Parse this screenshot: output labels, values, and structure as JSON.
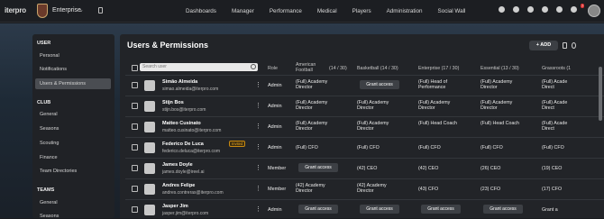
{
  "app": {
    "logo": "iterpro",
    "team": "Enterprise",
    "nav": [
      "Dashboards",
      "Manager",
      "Performance",
      "Medical",
      "Players",
      "Administration",
      "Social Wall"
    ],
    "notif_count": "7"
  },
  "sidebar": {
    "user_title": "USER",
    "user_items": [
      "Personal",
      "Notifications",
      "Users & Permissions"
    ],
    "club_title": "CLUB",
    "club_items": [
      "General",
      "Seasons",
      "Scouting",
      "Finance",
      "Team Directories"
    ],
    "teams_title": "TEAMS",
    "teams_items": [
      "General",
      "Seasons"
    ]
  },
  "main": {
    "title": "Users & Permissions",
    "add_label": "+ ADD",
    "search_placeholder": "Search user",
    "columns": [
      "Role",
      "American Football",
      "(14 / 30)",
      "Basketball (14 / 30)",
      "Enterprise (17 / 30)",
      "Essential (13 / 30)",
      "Grassroots (1"
    ],
    "rows": [
      {
        "name": "Simão Almeida",
        "email": "simao.almeida@iterpro.com",
        "role": "Admin",
        "tag": "",
        "af": "(Full) Academy Director",
        "bb": "Grant access",
        "ent": "(Full) Head of Performance",
        "ess": "(Full) Academy Director",
        "gr": "(Full) Acade Direct"
      },
      {
        "name": "Stijn Bos",
        "email": "stijn.bos@iterpro.com",
        "role": "Admin",
        "tag": "",
        "af": "(Full) Academy Director",
        "bb": "(Full) Academy Director",
        "ent": "(Full) Academy Director",
        "ess": "(Full) Academy Director",
        "gr": "(Full) Acade Direct"
      },
      {
        "name": "Matteo Cusinato",
        "email": "matteo.cusinato@iterpro.com",
        "role": "Admin",
        "tag": "",
        "af": "(Full) Academy Director",
        "bb": "(Full) Academy Director",
        "ent": "(Full) Head Coach",
        "ess": "(Full) Head Coach",
        "gr": "(Full) Acade Direct"
      },
      {
        "name": "Federico De Luca",
        "email": "federico.deluca@iterpro.com",
        "role": "Admin",
        "tag": "Invited",
        "af": "(Full) CFO",
        "bb": "(Full) CFO",
        "ent": "(Full) CFO",
        "ess": "(Full) CFO",
        "gr": "(Full) CFO"
      },
      {
        "name": "James Doyle",
        "email": "james.doyle@ireel.ai",
        "role": "Member",
        "tag": "",
        "af": "Grant access",
        "bb": "(42) CEO",
        "ent": "(42) CEO",
        "ess": "(26) CEO",
        "gr": "(19) CEO"
      },
      {
        "name": "Andres Felipe",
        "email": "andres.contreras@iterpro.com",
        "role": "Member",
        "tag": "",
        "af": "(42) Academy Director",
        "bb": "(42) Academy Director",
        "ent": "(43) CFO",
        "ess": "(23) CFO",
        "gr": "(17) CFO"
      },
      {
        "name": "Jasper Jim",
        "email": "jasper.jim@iterpro.com",
        "role": "Admin",
        "tag": "",
        "af": "Grant access",
        "bb": "Grant access",
        "ent": "Grant access",
        "ess": "Grant access",
        "gr": "Grant a"
      }
    ]
  }
}
